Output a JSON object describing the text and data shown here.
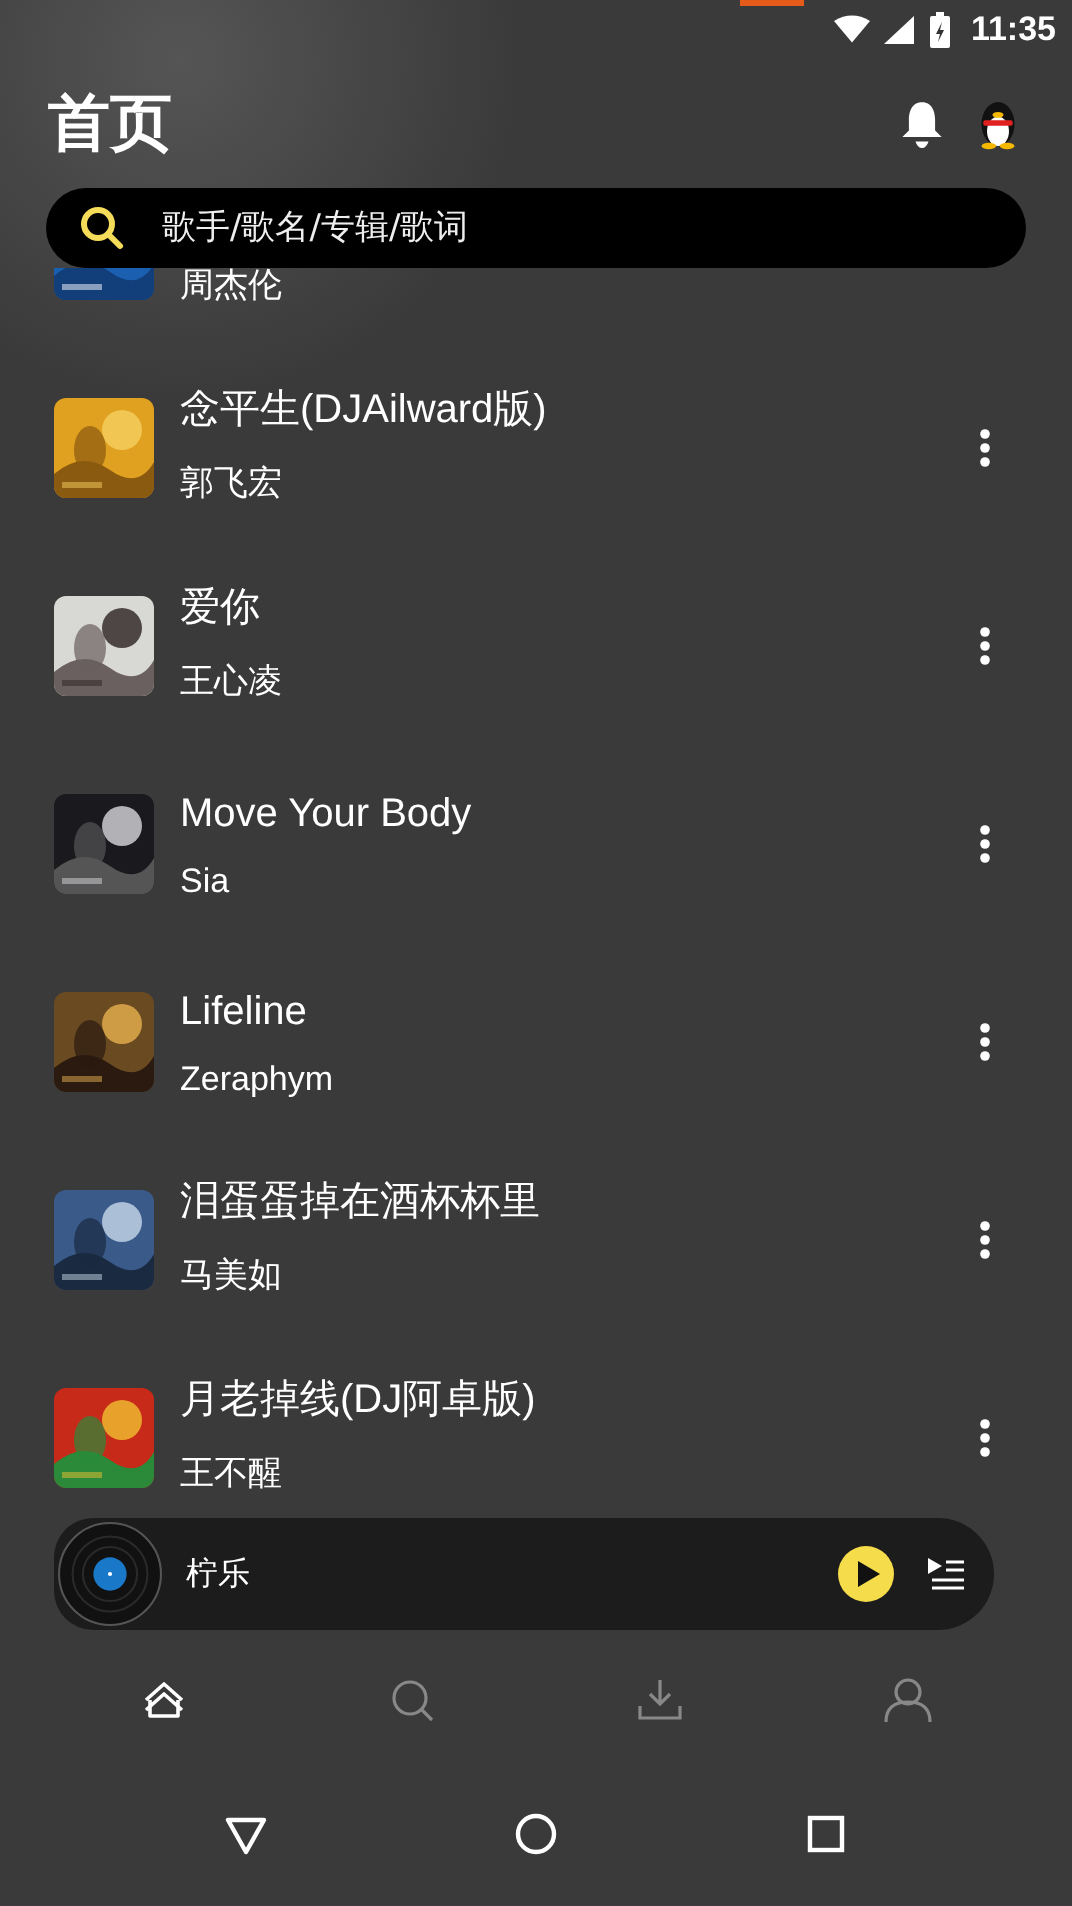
{
  "status_bar": {
    "time": "11:35"
  },
  "header": {
    "title": "首页"
  },
  "search": {
    "placeholder": "歌手/歌名/专辑/歌词"
  },
  "songs": [
    {
      "artist": "周杰伦"
    },
    {
      "title": "念平生(DJAilward版)",
      "artist": "郭飞宏"
    },
    {
      "title": "爱你",
      "artist": "王心凌"
    },
    {
      "title": "Move Your Body",
      "artist": "Sia"
    },
    {
      "title": "Lifeline",
      "artist": "Zeraphym"
    },
    {
      "title": "泪蛋蛋掉在酒杯杯里",
      "artist": "马美如"
    },
    {
      "title": "月老掉线(DJ阿卓版)",
      "artist": "王不醒"
    }
  ],
  "player": {
    "title": "柠乐",
    "playing": false
  },
  "nav_tabs": [
    {
      "kind": "home",
      "selected": true
    },
    {
      "kind": "search",
      "selected": false
    },
    {
      "kind": "download",
      "selected": false
    },
    {
      "kind": "profile",
      "selected": false
    }
  ],
  "system_nav": [
    {
      "kind": "back"
    },
    {
      "kind": "home"
    },
    {
      "kind": "recents"
    }
  ]
}
